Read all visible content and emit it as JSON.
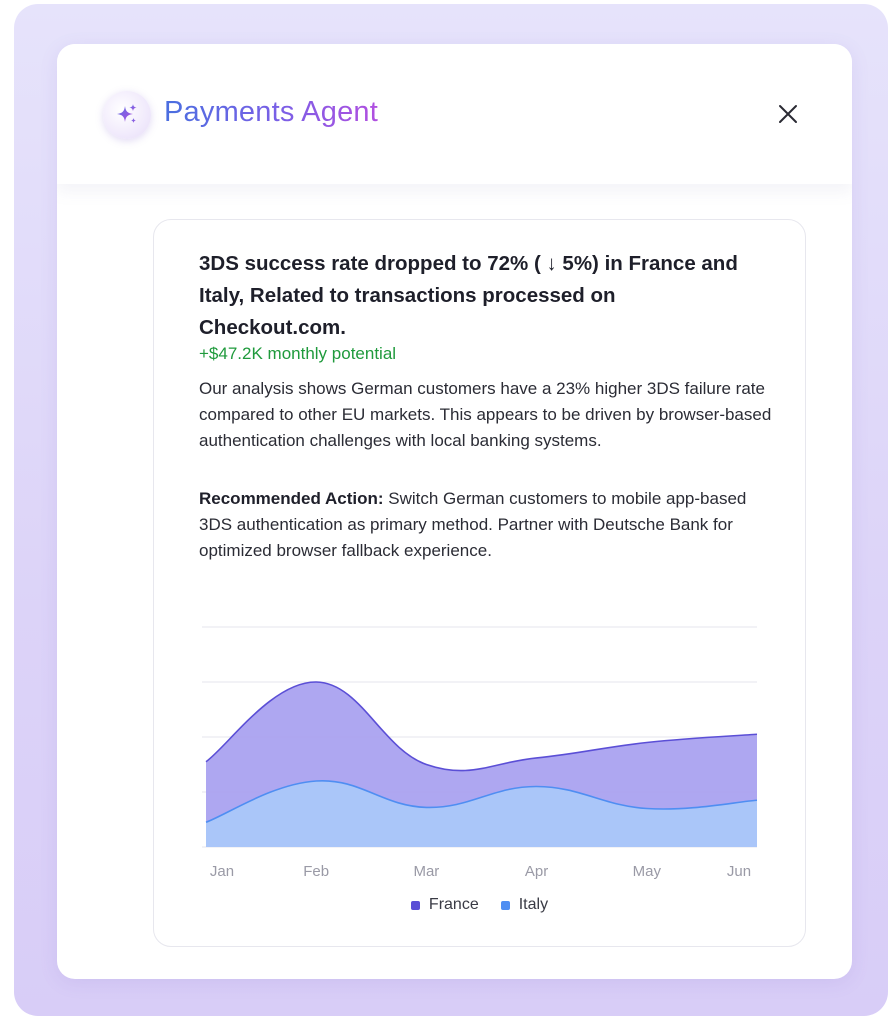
{
  "header": {
    "title": "Payments Agent",
    "logo_icon": "sparkles-icon",
    "close_icon": "close-icon"
  },
  "insight": {
    "headline": "3DS success rate dropped to 72% ( ↓ 5%) in France and Italy, Related to transactions processed on Checkout.com.",
    "potential": "+$47.2K monthly potential",
    "analysis": "Our analysis shows German customers have a 23% higher 3DS failure rate compared to other EU markets. This appears to be driven by browser-based authentication challenges with local banking systems.",
    "recommendation_label": "Recommended Action:",
    "recommendation_text": "Switch German customers to mobile app-based 3DS authentication as primary method. Partner with Deutsche Bank for optimized browser fallback experience."
  },
  "colors": {
    "france": "#5b4fd6",
    "italy": "#4f8ef2",
    "positive": "#1f9a3c"
  },
  "chart_data": {
    "type": "area",
    "categories": [
      "Jan",
      "Feb",
      "Mar",
      "Apr",
      "May",
      "Jun"
    ],
    "series": [
      {
        "name": "France",
        "values": [
          155,
          300,
          150,
          162,
          190,
          205
        ]
      },
      {
        "name": "Italy",
        "values": [
          45,
          120,
          72,
          110,
          70,
          85
        ]
      }
    ],
    "ylim": [
      0,
      400
    ],
    "grid": true,
    "legend": "bottom-center"
  }
}
